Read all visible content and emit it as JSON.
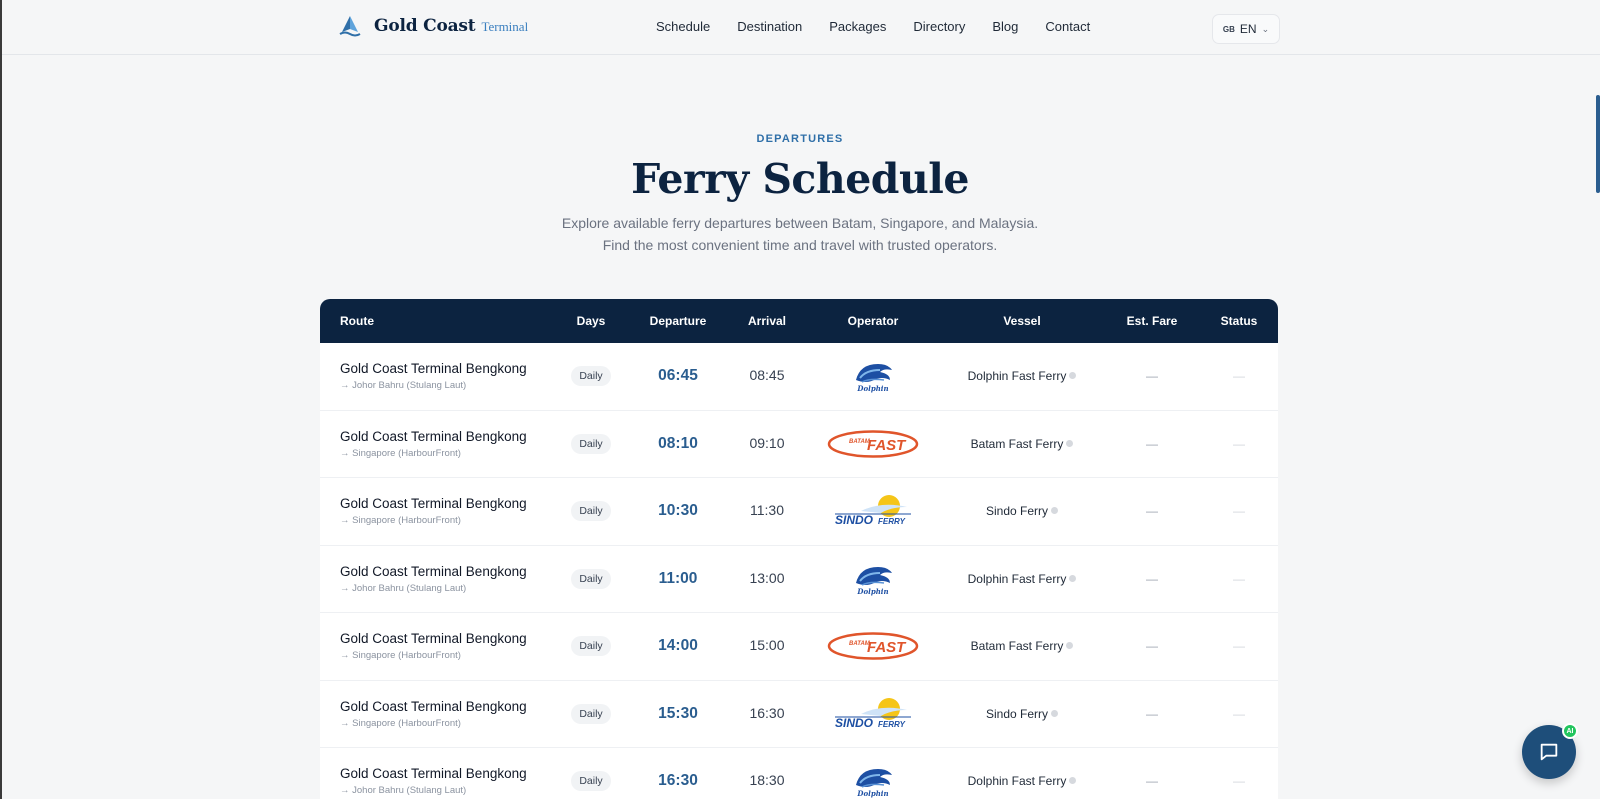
{
  "brand": {
    "name": "Gold Coast",
    "sub": "Terminal"
  },
  "nav": [
    "Schedule",
    "Destination",
    "Packages",
    "Directory",
    "Blog",
    "Contact"
  ],
  "language": {
    "flag": "GB",
    "code": "EN"
  },
  "hero": {
    "eyebrow": "DEPARTURES",
    "title": "Ferry Schedule",
    "subtitle": "Explore available ferry departures between Batam, Singapore, and Malaysia. Find the most convenient time and travel with trusted operators."
  },
  "table": {
    "headers": {
      "route": "Route",
      "days": "Days",
      "departure": "Departure",
      "arrival": "Arrival",
      "operator": "Operator",
      "vessel": "Vessel",
      "fare": "Est. Fare",
      "status": "Status"
    },
    "rows": [
      {
        "route": "Gold Coast Terminal Bengkong",
        "dest": "→ Johor Bahru (Stulang Laut)",
        "days": "Daily",
        "dep": "06:45",
        "arr": "08:45",
        "operator": "dolphin",
        "vessel": "Dolphin Fast Ferry",
        "fare": "—",
        "status": "—"
      },
      {
        "route": "Gold Coast Terminal Bengkong",
        "dest": "→ Singapore (HarbourFront)",
        "days": "Daily",
        "dep": "08:10",
        "arr": "09:10",
        "operator": "batamfast",
        "vessel": "Batam Fast Ferry",
        "fare": "—",
        "status": "—"
      },
      {
        "route": "Gold Coast Terminal Bengkong",
        "dest": "→ Singapore (HarbourFront)",
        "days": "Daily",
        "dep": "10:30",
        "arr": "11:30",
        "operator": "sindo",
        "vessel": "Sindo Ferry",
        "fare": "—",
        "status": "—"
      },
      {
        "route": "Gold Coast Terminal Bengkong",
        "dest": "→ Johor Bahru (Stulang Laut)",
        "days": "Daily",
        "dep": "11:00",
        "arr": "13:00",
        "operator": "dolphin",
        "vessel": "Dolphin Fast Ferry",
        "fare": "—",
        "status": "—"
      },
      {
        "route": "Gold Coast Terminal Bengkong",
        "dest": "→ Singapore (HarbourFront)",
        "days": "Daily",
        "dep": "14:00",
        "arr": "15:00",
        "operator": "batamfast",
        "vessel": "Batam Fast Ferry",
        "fare": "—",
        "status": "—"
      },
      {
        "route": "Gold Coast Terminal Bengkong",
        "dest": "→ Singapore (HarbourFront)",
        "days": "Daily",
        "dep": "15:30",
        "arr": "16:30",
        "operator": "sindo",
        "vessel": "Sindo Ferry",
        "fare": "—",
        "status": "—"
      },
      {
        "route": "Gold Coast Terminal Bengkong",
        "dest": "→ Johor Bahru (Stulang Laut)",
        "days": "Daily",
        "dep": "16:30",
        "arr": "18:30",
        "operator": "dolphin",
        "vessel": "Dolphin Fast Ferry",
        "fare": "—",
        "status": "—"
      }
    ]
  },
  "operator_logos": {
    "dolphin": {
      "text": "Dolphin",
      "icon": "dolphin-logo-icon"
    },
    "batamfast": {
      "text_small": "BATAM",
      "text_big": "FAST",
      "icon": "batam-fast-logo-icon"
    },
    "sindo": {
      "text": "SINDO",
      "text_small": "FERRY",
      "icon": "sindo-ferry-logo-icon"
    }
  },
  "chat": {
    "badge": "AI",
    "icon": "chat-bubble-icon"
  },
  "colors": {
    "navy": "#0c2340",
    "accent": "#2a5d8f",
    "eyebrow": "#2f6fa8",
    "batam": "#e0552b",
    "sindo_blue": "#1d4fa3",
    "sindo_sun": "#f5c518"
  }
}
